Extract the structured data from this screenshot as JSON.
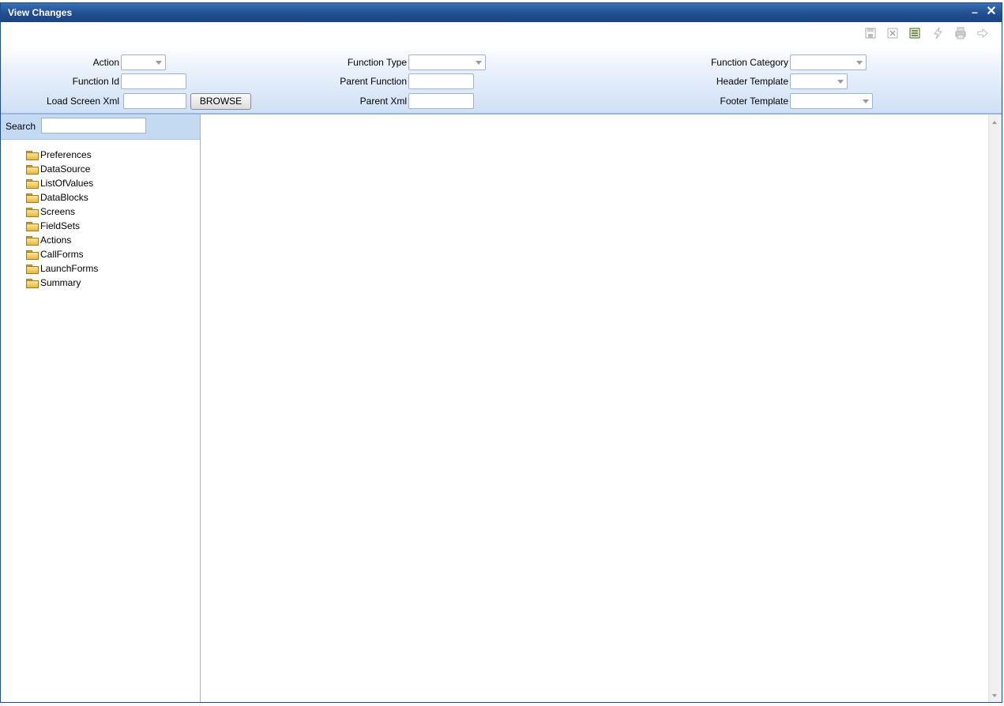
{
  "window": {
    "title": "View Changes",
    "minimize_glyph": "–",
    "close_glyph": "✕"
  },
  "toolbar": {
    "icons": [
      "save-icon",
      "delete-icon",
      "notes-icon",
      "flash-icon",
      "print-icon",
      "exit-icon"
    ]
  },
  "form": {
    "action_label": "Action",
    "action_value": "",
    "function_id_label": "Function Id",
    "function_id_value": "",
    "load_screen_xml_label": "Load Screen Xml",
    "load_screen_xml_value": "",
    "browse_label": "BROWSE",
    "function_type_label": "Function Type",
    "function_type_value": "",
    "parent_function_label": "Parent Function",
    "parent_function_value": "",
    "parent_xml_label": "Parent Xml",
    "parent_xml_value": "",
    "function_category_label": "Function Category",
    "function_category_value": "",
    "header_template_label": "Header Template",
    "header_template_value": "",
    "footer_template_label": "Footer Template",
    "footer_template_value": ""
  },
  "sidebar": {
    "search_label": "Search",
    "search_value": "",
    "items": [
      {
        "label": "Preferences"
      },
      {
        "label": "DataSource"
      },
      {
        "label": "ListOfValues"
      },
      {
        "label": "DataBlocks"
      },
      {
        "label": "Screens"
      },
      {
        "label": "FieldSets"
      },
      {
        "label": "Actions"
      },
      {
        "label": "CallForms"
      },
      {
        "label": "LaunchForms"
      },
      {
        "label": "Summary"
      }
    ]
  },
  "colors": {
    "titlebar": "#214f91",
    "panel_gradient_end": "#cfe0f6",
    "search_bar": "#c4daf3"
  }
}
